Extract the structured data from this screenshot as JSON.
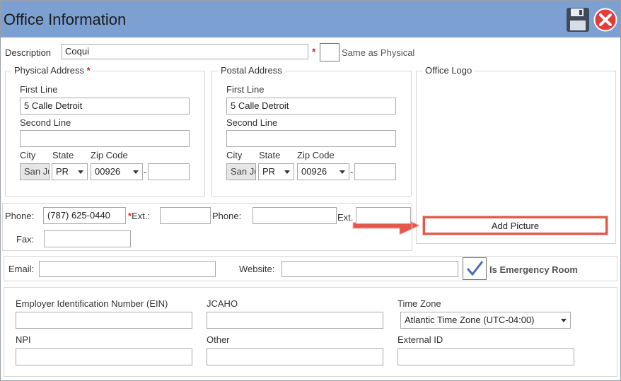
{
  "window": {
    "title": "Office Information"
  },
  "toolbar": {
    "save_icon": "save-disk-icon",
    "close_icon": "close-x-icon"
  },
  "description": {
    "label": "Description",
    "value": "Coqui",
    "same_as_physical": "Same as Physical"
  },
  "physical": {
    "legend": "Physical Address",
    "first_line_label": "First Line",
    "first_line": "5 Calle Detroit",
    "second_line_label": "Second Line",
    "second_line": "",
    "city_label": "City",
    "city": "San Ju",
    "state_label": "State",
    "state": "PR",
    "zip_label": "Zip Code",
    "zip": "00926",
    "zip_ext": "",
    "dash": "-"
  },
  "postal": {
    "legend": "Postal Address",
    "first_line_label": "First Line",
    "first_line": "5 Calle Detroit",
    "second_line_label": "Second Line",
    "second_line": "",
    "city_label": "City",
    "city": "San Ju",
    "state_label": "State",
    "state": "PR",
    "zip_label": "Zip Code",
    "zip": "00926",
    "zip_ext": "",
    "dash": "-"
  },
  "logo": {
    "legend": "Office Logo",
    "add_picture": "Add Picture"
  },
  "phones": {
    "phone_label": "Phone:",
    "phone": "(787) 625-0440",
    "ext_label": "Ext.:",
    "ext": "",
    "phone2_label": "Phone:",
    "phone2": "",
    "ext2_label": "Ext.",
    "ext2": "",
    "fax_label": "Fax:",
    "fax": ""
  },
  "contact": {
    "email_label": "Email:",
    "email": "",
    "website_label": "Website:",
    "website": "",
    "emergency_label": "Is Emergency Room",
    "emergency_checked": true
  },
  "ids": {
    "ein_label": "Employer Identification Number (EIN)",
    "ein": "",
    "jcaho_label": "JCAHO",
    "jcaho": "",
    "timezone_label": "Time Zone",
    "timezone": "Atlantic Time Zone (UTC-04:00)",
    "npi_label": "NPI",
    "npi": "",
    "other_label": "Other",
    "other": "",
    "external_label": "External ID",
    "external": ""
  },
  "colors": {
    "titlebar": "#7da0d3",
    "required": "#d22222",
    "highlight": "#e4584b"
  }
}
